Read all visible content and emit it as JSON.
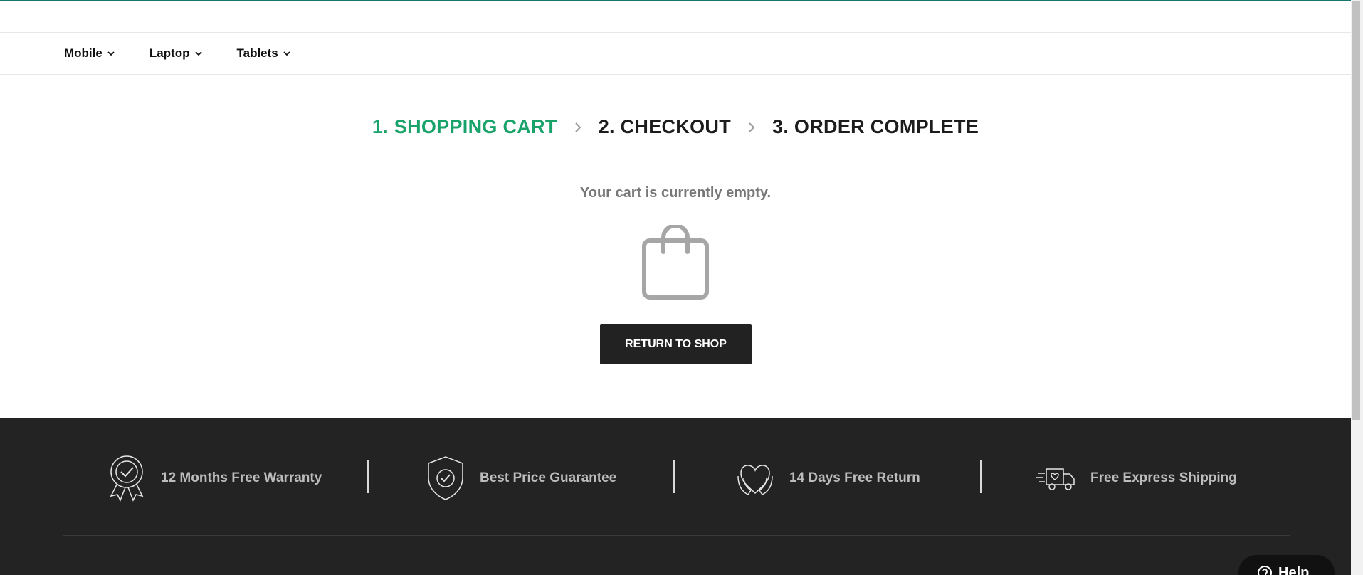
{
  "nav": {
    "items": [
      {
        "label": "Mobile"
      },
      {
        "label": "Laptop"
      },
      {
        "label": "Tablets"
      }
    ]
  },
  "steps": [
    {
      "label": "1. SHOPPING CART",
      "active": true
    },
    {
      "label": "2. CHECKOUT",
      "active": false
    },
    {
      "label": "3. ORDER COMPLETE",
      "active": false
    }
  ],
  "cart": {
    "empty_message": "Your cart is currently empty.",
    "return_button_label": "RETURN TO SHOP",
    "icon": "shopping-bag-icon"
  },
  "footer": {
    "features": [
      {
        "label": "12 Months Free Warranty",
        "icon": "award-badge-icon"
      },
      {
        "label": "Best Price Guarantee",
        "icon": "shield-check-icon"
      },
      {
        "label": "14 Days Free Return",
        "icon": "heart-hands-icon"
      },
      {
        "label": "Free Express Shipping",
        "icon": "delivery-truck-icon"
      }
    ]
  },
  "help": {
    "label": "Help"
  },
  "colors": {
    "accent": "#19a36b",
    "top_bar": "#17766d",
    "footer_bg": "#232323",
    "button_bg": "#222222"
  }
}
